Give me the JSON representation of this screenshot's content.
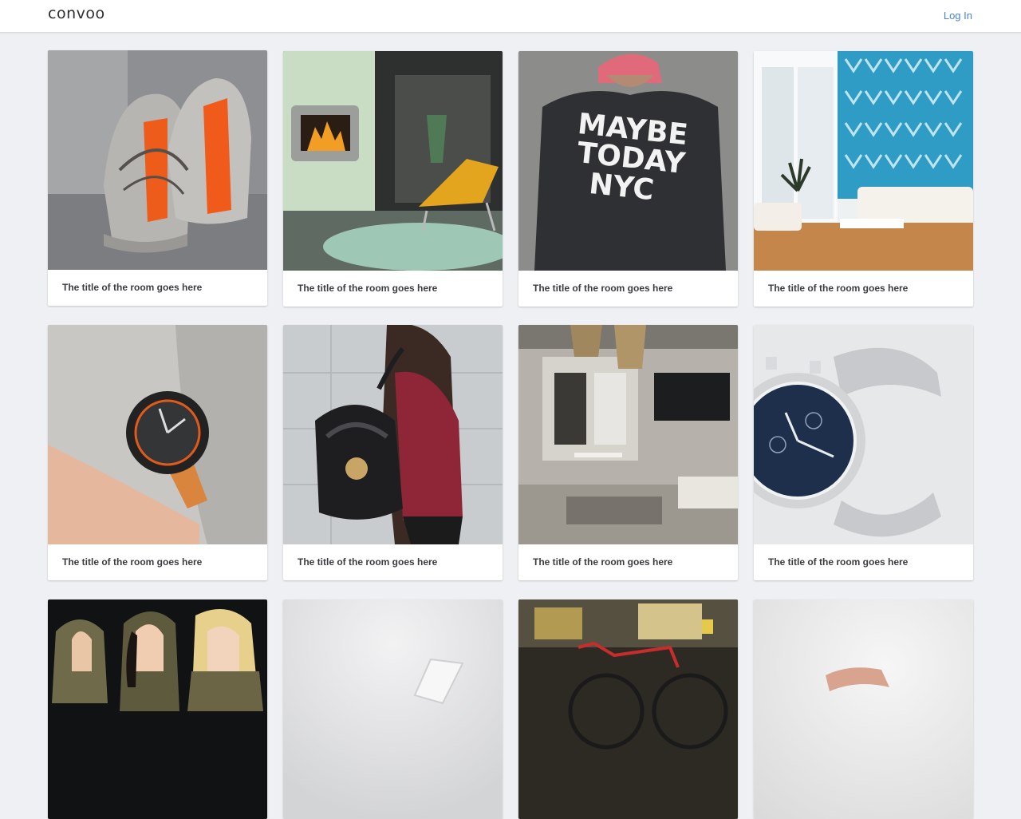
{
  "header": {
    "logo": "convoo",
    "login_label": "Log In"
  },
  "colors": {
    "link": "#4a86c8",
    "page_bg": "#eef0f3"
  },
  "rooms": [
    {
      "title": "The title of the room goes here",
      "image": "knitted-sneakers"
    },
    {
      "title": "The title of the room goes here",
      "image": "fireplace-lounge-chair"
    },
    {
      "title": "The title of the room goes here",
      "image": "maybe-today-nyc-sweatshirt",
      "image_text": [
        "MAYBE",
        "TODAY",
        "NYC"
      ]
    },
    {
      "title": "The title of the room goes here",
      "image": "living-room-blue-wall"
    },
    {
      "title": "The title of the room goes here",
      "image": "wristwatch-orange-strap"
    },
    {
      "title": "The title of the room goes here",
      "image": "woman-black-backpack"
    },
    {
      "title": "The title of the room goes here",
      "image": "open-plan-kitchen-living"
    },
    {
      "title": "The title of the room goes here",
      "image": "silver-mesh-watch"
    },
    {
      "title": "",
      "image": "women-camouflage-hoodies"
    },
    {
      "title": "",
      "image": "white-device-grey-background"
    },
    {
      "title": "",
      "image": "street-red-bicycle"
    },
    {
      "title": "",
      "image": "rose-gold-object"
    }
  ]
}
